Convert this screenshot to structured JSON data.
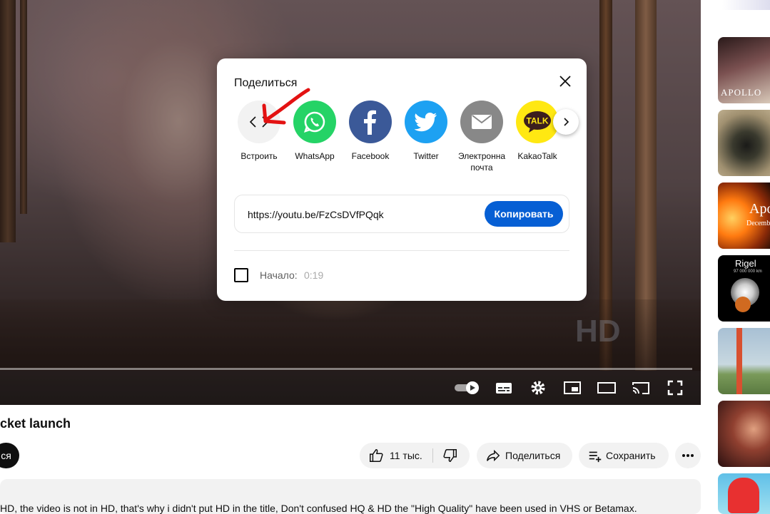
{
  "video": {
    "watermark": "HD"
  },
  "page": {
    "title": "cket launch",
    "subscribe_partial": "ся",
    "likes": "11 тыс.",
    "share": "Поделиться",
    "save": "Сохранить",
    "description": "HD, the video is not in HD, that's why i didn't put HD in the title, Don't confused HQ & HD the \"High Quality\" have been used in VHS or Betamax."
  },
  "sidebar": {
    "thumbs": [
      {
        "text": "APOLLO",
        "colors": [
          "#4a3a3a",
          "#c8b8a8"
        ]
      },
      {
        "text": "",
        "colors": [
          "#3a3a30",
          "#8a8a70"
        ]
      },
      {
        "text": "Apo",
        "sub": "Decemb",
        "colors": [
          "#ff8a1a",
          "#2a1a10"
        ]
      },
      {
        "text": "Rigel",
        "sub": "97 000 000 km",
        "colors": [
          "#000000",
          "#202020"
        ]
      },
      {
        "text": "",
        "colors": [
          "#9ab4c8",
          "#6a8a5a"
        ]
      },
      {
        "text": "",
        "colors": [
          "#3a2018",
          "#c07050"
        ]
      },
      {
        "text": "",
        "colors": [
          "#e03030",
          "#f0c0a0"
        ]
      }
    ]
  },
  "dialog": {
    "title": "Поделиться",
    "items": [
      {
        "label": "Встроить",
        "icon": "embed-icon",
        "bg": "#f2f2f2"
      },
      {
        "label": "WhatsApp",
        "icon": "whatsapp-icon",
        "bg": "#25d366"
      },
      {
        "label": "Facebook",
        "icon": "facebook-icon",
        "bg": "#3b5998"
      },
      {
        "label": "Twitter",
        "icon": "twitter-icon",
        "bg": "#1da1f2"
      },
      {
        "label": "Электронна\nпочта",
        "icon": "email-icon",
        "bg": "#888888"
      },
      {
        "label": "KakaoTalk",
        "icon": "kakaotalk-icon",
        "bg": "#ffe812",
        "icon_text": "TALK"
      }
    ],
    "url": "https://youtu.be/FzCsDVfPQqk",
    "copy_label": "Копировать",
    "start_label": "Начало:",
    "start_time": "0:19",
    "accent": "#065fd4"
  }
}
